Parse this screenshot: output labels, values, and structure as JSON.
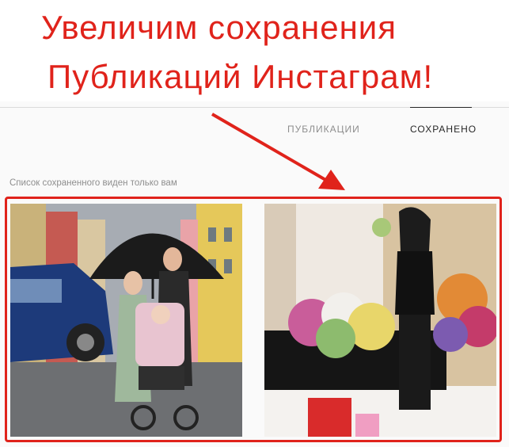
{
  "banner": {
    "line1": "Увеличим сохранения",
    "line2": "Публикаций Инстаграм!"
  },
  "tabs": [
    {
      "label": "ПУБЛИКАЦИИ",
      "active": false
    },
    {
      "label": "СОХРАНЕНО",
      "active": true
    }
  ],
  "notice": "Список сохраненного виден только вам",
  "colors": {
    "accent_red": "#e0231b",
    "tab_active": "#262626",
    "tab_inactive": "#8e8e8e"
  }
}
